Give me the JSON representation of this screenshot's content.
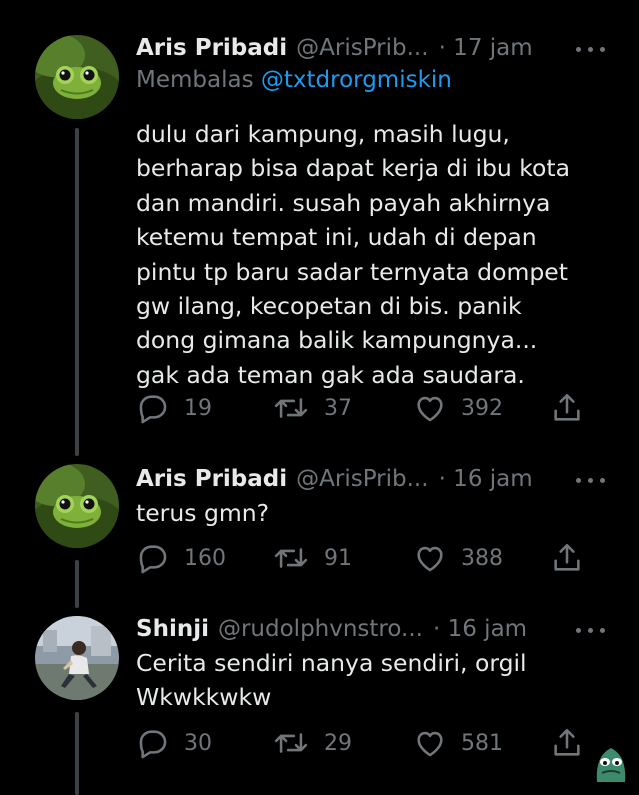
{
  "tweets": [
    {
      "name": "Aris Pribadi",
      "handle": "@ArisPrib...",
      "time": "· 17 jam",
      "replying_label": "Membalas",
      "replying_to": "@txtdrorgmiskin",
      "lines": [
        "dulu dari kampung, masih lugu,",
        "berharap bisa dapat kerja di ibu kota",
        "dan mandiri. susah payah akhirnya",
        "ketemu tempat ini, udah di depan",
        "pintu tp baru sadar ternyata dompet",
        "gw ilang, kecopetan di bis. panik",
        "dong gimana balik kampungnya...",
        "gak ada teman gak ada saudara."
      ],
      "replies": "19",
      "retweets": "37",
      "likes": "392"
    },
    {
      "name": "Aris Pribadi",
      "handle": "@ArisPrib...",
      "time": "· 16 jam",
      "lines": [
        "terus gmn?"
      ],
      "replies": "160",
      "retweets": "91",
      "likes": "388"
    },
    {
      "name": "Shinji",
      "handle": "@rudolphvnstro...",
      "time": "· 16 jam",
      "lines": [
        "Cerita sendiri nanya sendiri, orgil",
        "Wkwkkwkw"
      ],
      "replies": "30",
      "retweets": "29",
      "likes": "581"
    }
  ],
  "colors": {
    "background": "#000000",
    "text": "#e7e9ea",
    "secondary": "#71767b",
    "link": "#1d9bf0",
    "thread_line": "#3e4144"
  },
  "icons": [
    "reply-icon",
    "retweet-icon",
    "like-icon",
    "share-icon",
    "more-icon",
    "sticker-icon"
  ]
}
